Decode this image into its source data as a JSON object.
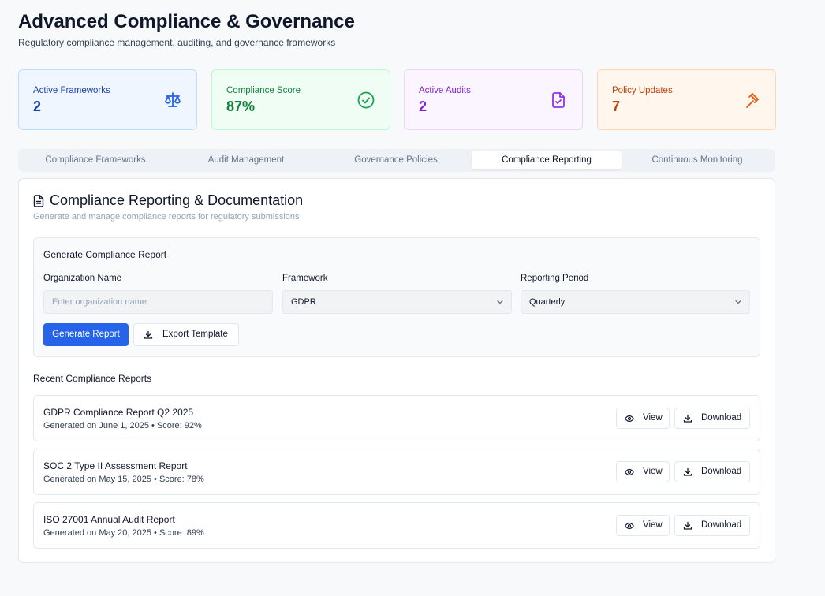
{
  "header": {
    "title": "Advanced Compliance & Governance",
    "subtitle": "Regulatory compliance management, auditing, and governance frameworks"
  },
  "stats": [
    {
      "label": "Active Frameworks",
      "value": "2",
      "icon": "scale-icon",
      "color": "#1e40af"
    },
    {
      "label": "Compliance Score",
      "value": "87%",
      "icon": "check-circle-icon",
      "color": "#15803d"
    },
    {
      "label": "Active Audits",
      "value": "2",
      "icon": "file-check-icon",
      "color": "#7e22ce"
    },
    {
      "label": "Policy Updates",
      "value": "7",
      "icon": "gavel-icon",
      "color": "#c2410c"
    }
  ],
  "tabs": [
    {
      "label": "Compliance Frameworks",
      "active": false
    },
    {
      "label": "Audit Management",
      "active": false
    },
    {
      "label": "Governance Policies",
      "active": false
    },
    {
      "label": "Compliance Reporting",
      "active": true
    },
    {
      "label": "Continuous Monitoring",
      "active": false
    }
  ],
  "card": {
    "title": "Compliance Reporting & Documentation",
    "description": "Generate and manage compliance reports for regulatory submissions"
  },
  "generator": {
    "title": "Generate Compliance Report",
    "org_label": "Organization Name",
    "org_placeholder": "Enter organization name",
    "org_value": "",
    "framework_label": "Framework",
    "framework_value": "GDPR",
    "period_label": "Reporting Period",
    "period_value": "Quarterly",
    "generate_label": "Generate Report",
    "export_label": "Export Template"
  },
  "recent": {
    "title": "Recent Compliance Reports",
    "view_label": "View",
    "download_label": "Download",
    "reports": [
      {
        "name": "GDPR Compliance Report Q2 2025",
        "meta": "Generated on June 1, 2025 • Score: 92%"
      },
      {
        "name": "SOC 2 Type II Assessment Report",
        "meta": "Generated on May 15, 2025 • Score: 78%"
      },
      {
        "name": "ISO 27001 Annual Audit Report",
        "meta": "Generated on May 20, 2025 • Score: 89%"
      }
    ]
  },
  "colors": {
    "accent": "#2563eb",
    "background": "#f8f9fb"
  }
}
